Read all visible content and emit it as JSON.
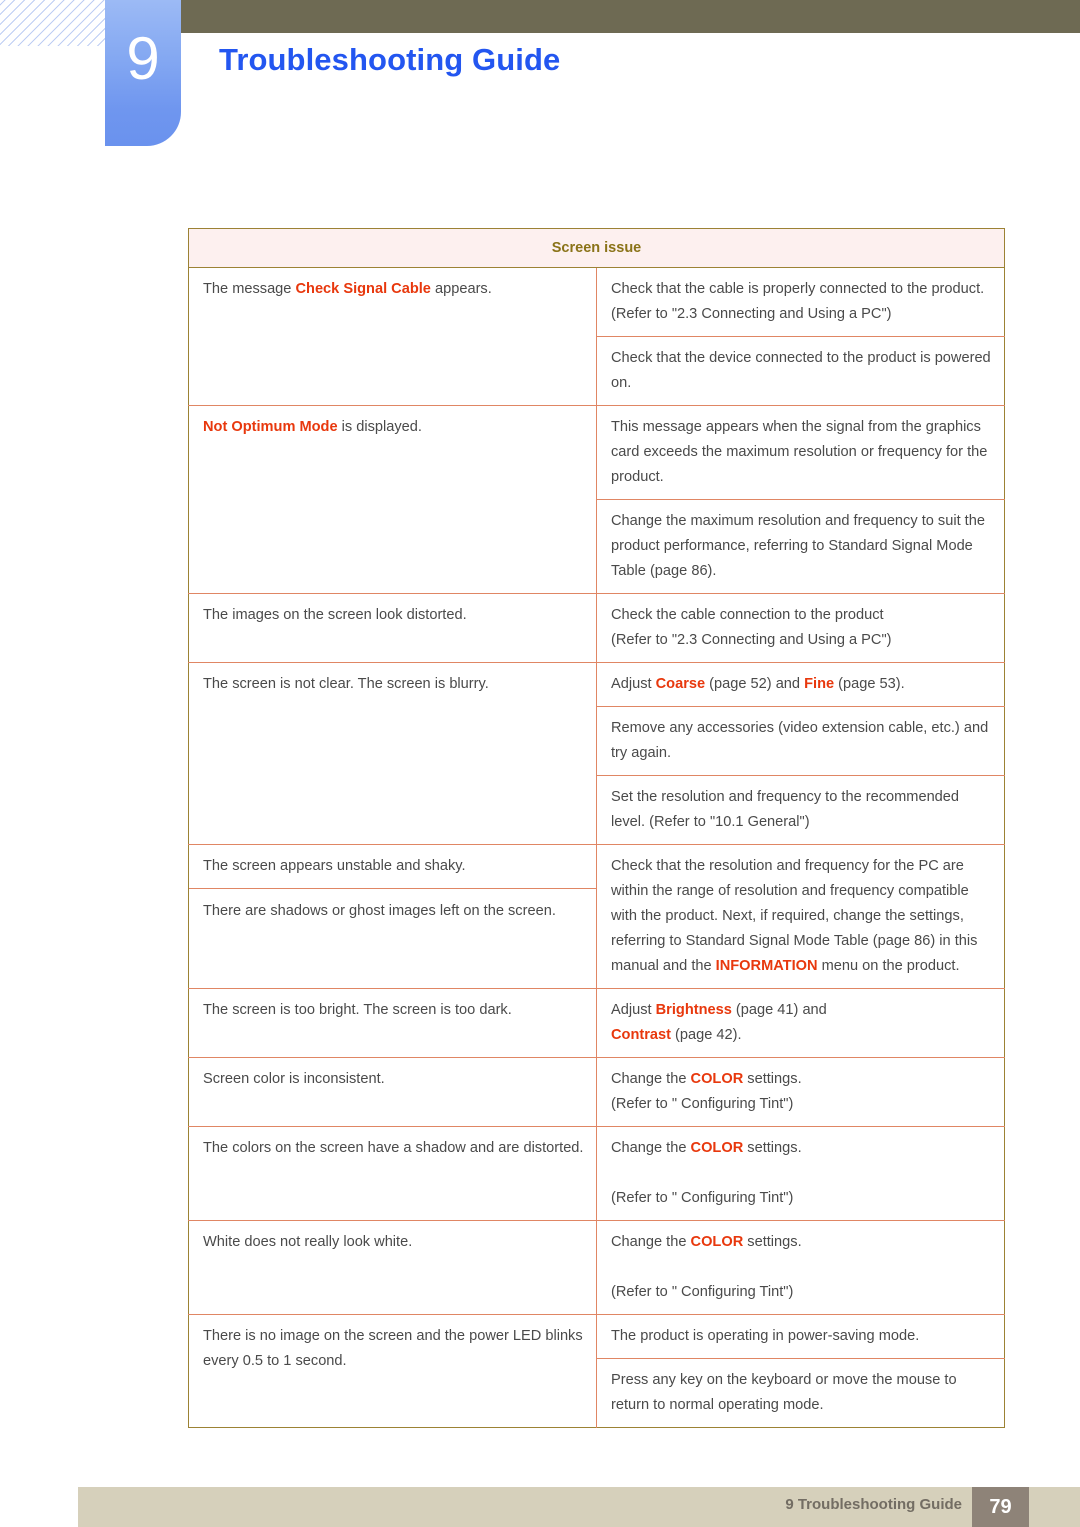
{
  "header": {
    "chapter_number": "9",
    "chapter_title": "Troubleshooting Guide"
  },
  "table": {
    "header": "Screen issue",
    "rows": [
      {
        "symptom_parts": [
          {
            "text": "The message ",
            "highlight": false
          },
          {
            "text": "Check Signal Cable",
            "highlight": true
          },
          {
            "text": " appears.",
            "highlight": false
          }
        ],
        "solutions": [
          [
            {
              "text": "Check that the cable is properly connected to the product.",
              "highlight": false
            },
            {
              "text": "\n",
              "highlight": false
            },
            {
              "text": "(Refer to \"2.3 Connecting and Using a PC\")",
              "highlight": false
            }
          ],
          [
            {
              "text": "Check that the device connected to the product is powered on.",
              "highlight": false
            }
          ]
        ]
      },
      {
        "symptom_parts": [
          {
            "text": "Not Optimum Mode",
            "highlight": true
          },
          {
            "text": " is displayed.",
            "highlight": false
          }
        ],
        "solutions": [
          [
            {
              "text": "This message appears when the signal from the graphics card exceeds the maximum resolution or frequency for the product.",
              "highlight": false
            }
          ],
          [
            {
              "text": "Change the maximum resolution and frequency to suit the product performance, referring to Standard Signal Mode Table (page 86).",
              "highlight": false
            }
          ]
        ]
      },
      {
        "symptom_parts": [
          {
            "text": "The images on the screen look distorted.",
            "highlight": false
          }
        ],
        "solutions": [
          [
            {
              "text": "Check the cable connection to the product",
              "highlight": false
            },
            {
              "text": "\n",
              "highlight": false
            },
            {
              "text": "(Refer to \"2.3 Connecting and Using a PC\")",
              "highlight": false
            }
          ]
        ]
      },
      {
        "symptom_parts": [
          {
            "text": "The screen is not clear. The screen is blurry.",
            "highlight": false
          }
        ],
        "solutions": [
          [
            {
              "text": "Adjust ",
              "highlight": false
            },
            {
              "text": "Coarse",
              "highlight": true
            },
            {
              "text": " (page 52) and ",
              "highlight": false
            },
            {
              "text": "Fine",
              "highlight": true
            },
            {
              "text": " (page 53).",
              "highlight": false
            }
          ],
          [
            {
              "text": "Remove any accessories (video extension cable, etc.) and try again.",
              "highlight": false
            }
          ],
          [
            {
              "text": "Set the resolution and frequency to the recommended level. (Refer to \"10.1 General\")",
              "highlight": false
            }
          ]
        ]
      },
      {
        "symptom_parts": [
          {
            "text": "The screen appears unstable and shaky.",
            "highlight": false
          }
        ],
        "symptom_parts_2": [
          {
            "text": "There are shadows or ghost images left on the screen.",
            "highlight": false
          }
        ],
        "solutions": [
          [
            {
              "text": "Check that the resolution and frequency for the PC are within the range of resolution and frequency compatible with the product. Next, if required, change the settings, referring to Standard Signal Mode Table (page 86) in this manual and the ",
              "highlight": false
            },
            {
              "text": "INFORMATION",
              "highlight": true
            },
            {
              "text": " menu on the product.",
              "highlight": false
            }
          ]
        ]
      },
      {
        "symptom_parts": [
          {
            "text": "The screen is too bright. The screen is too dark.",
            "highlight": false
          }
        ],
        "solutions": [
          [
            {
              "text": "Adjust ",
              "highlight": false
            },
            {
              "text": "Brightness",
              "highlight": true
            },
            {
              "text": " (page 41) and ",
              "highlight": false
            },
            {
              "text": "\n",
              "highlight": false
            },
            {
              "text": "Contrast",
              "highlight": true
            },
            {
              "text": " (page 42).",
              "highlight": false
            }
          ]
        ]
      },
      {
        "symptom_parts": [
          {
            "text": "Screen color is inconsistent.",
            "highlight": false
          }
        ],
        "solutions": [
          [
            {
              "text": "Change the ",
              "highlight": false
            },
            {
              "text": "COLOR",
              "highlight": true
            },
            {
              "text": " settings.",
              "highlight": false
            },
            {
              "text": "\n",
              "highlight": false
            },
            {
              "text": "(Refer to \" Configuring Tint\")",
              "highlight": false
            }
          ]
        ]
      },
      {
        "symptom_parts": [
          {
            "text": "The colors on the screen have a shadow and are distorted.",
            "highlight": false
          }
        ],
        "solutions": [
          [
            {
              "text": "Change the ",
              "highlight": false
            },
            {
              "text": "COLOR",
              "highlight": true
            },
            {
              "text": " settings.",
              "highlight": false
            },
            {
              "text": "\n\n",
              "highlight": false
            },
            {
              "text": "(Refer to \" Configuring Tint\")",
              "highlight": false
            }
          ]
        ]
      },
      {
        "symptom_parts": [
          {
            "text": "White does not really look white.",
            "highlight": false
          }
        ],
        "solutions": [
          [
            {
              "text": "Change the ",
              "highlight": false
            },
            {
              "text": "COLOR",
              "highlight": true
            },
            {
              "text": " settings.",
              "highlight": false
            },
            {
              "text": "\n\n",
              "highlight": false
            },
            {
              "text": "(Refer to \" Configuring Tint\")",
              "highlight": false
            }
          ]
        ]
      },
      {
        "symptom_parts": [
          {
            "text": "There is no image on the screen and the power LED blinks every 0.5 to 1 second.",
            "highlight": false
          }
        ],
        "solutions": [
          [
            {
              "text": "The product is operating in power-saving mode.",
              "highlight": false
            }
          ],
          [
            {
              "text": "Press any key on the keyboard or move the mouse to return to normal operating mode.",
              "highlight": false
            }
          ]
        ]
      }
    ]
  },
  "footer": {
    "label": "9 Troubleshooting Guide",
    "page_number": "79"
  },
  "colors": {
    "accent_blue": "#2356f0",
    "tab_blue": "#84a8f2",
    "olive_bar": "#6e6a53",
    "table_border": "#9c8234",
    "row_border": "#e08664",
    "header_bg": "#fdf0ef",
    "header_text": "#8a7318",
    "highlight_red": "#e8380d",
    "footer_bar": "#d6d0bb",
    "footer_page_box": "#8e8378"
  }
}
